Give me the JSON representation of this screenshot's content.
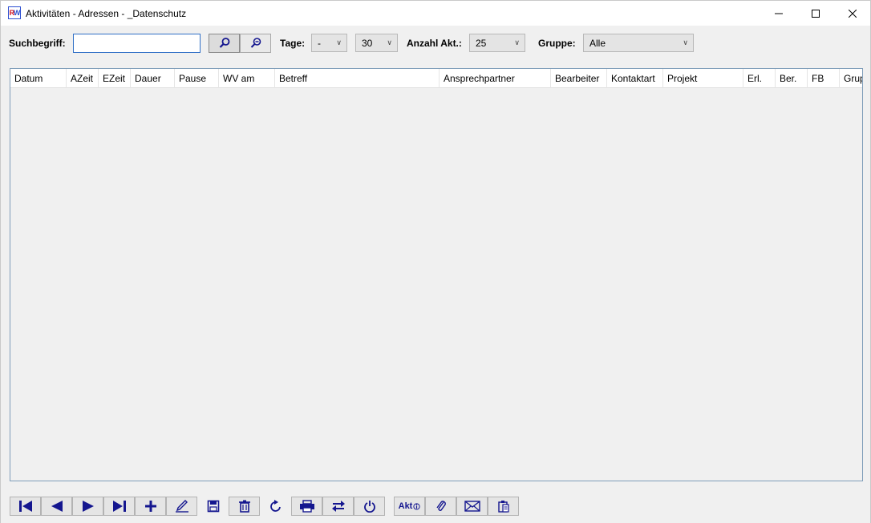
{
  "window": {
    "title": "Aktivitäten - Adressen - _Datenschutz",
    "app_icon": {
      "name": "rw-app-icon",
      "letter1": "R",
      "letter2": "W"
    },
    "controls": [
      "minimize-icon",
      "maximize-icon",
      "close-icon"
    ]
  },
  "toolbar": {
    "search_label": "Suchbegriff:",
    "search_value": "",
    "search_button_icon": "search-icon",
    "search_minus_button_icon": "search-minus-icon",
    "tage_label": "Tage:",
    "tage_value1": "-",
    "tage_value2": "30",
    "anzahl_label": "Anzahl Akt.:",
    "anzahl_value": "25",
    "gruppe_label": "Gruppe:",
    "gruppe_value": "Alle"
  },
  "grid": {
    "columns": [
      "Datum",
      "AZeit",
      "EZeit",
      "Dauer",
      "Pause",
      "WV am",
      "Betreff",
      "Ansprechpartner",
      "Bearbeiter",
      "Kontaktart",
      "Projekt",
      "Erl.",
      "Ber.",
      "FB",
      "Grup"
    ],
    "rows": []
  },
  "bottom": {
    "buttons": [
      "first-icon",
      "previous-icon",
      "next-icon",
      "last-icon",
      "add-icon",
      "edit-icon",
      "save-icon",
      "delete-icon",
      "refresh-icon",
      "print-icon",
      "swap-icon",
      "power-icon",
      "akt-info-icon",
      "attachment-icon",
      "mail-icon",
      "clipboard-icon"
    ],
    "akt_label": "Akt"
  },
  "colors": {
    "accent": "#14168f",
    "input_border": "#2f6fc6",
    "grid_border": "#7f9db9"
  }
}
